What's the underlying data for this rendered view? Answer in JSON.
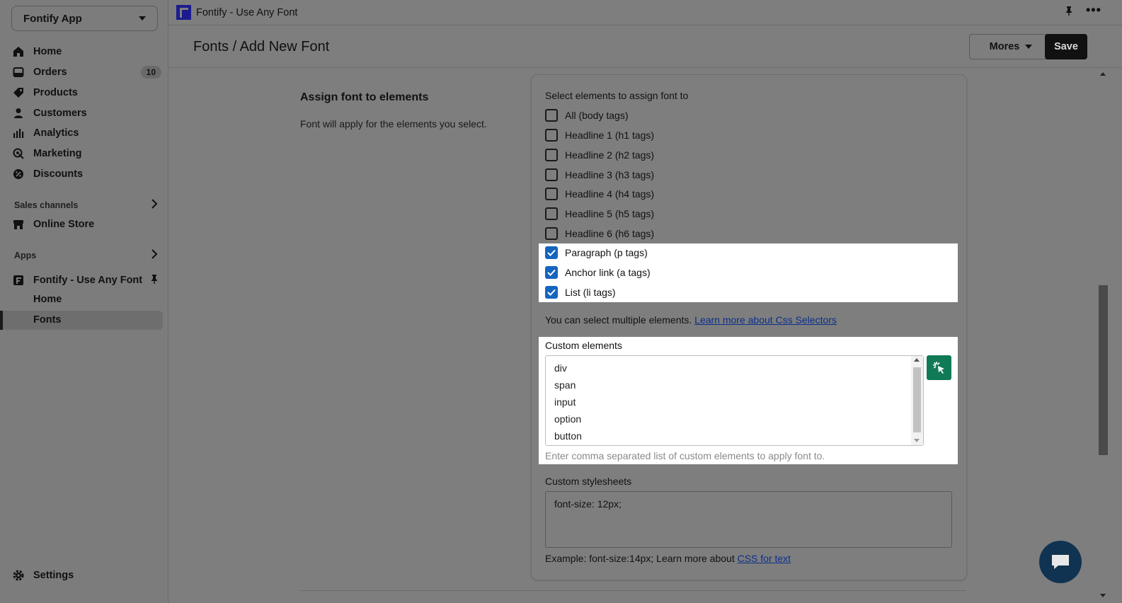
{
  "sidebar": {
    "store_name": "Fontify App",
    "items": [
      {
        "label": "Home",
        "icon": "home-icon"
      },
      {
        "label": "Orders",
        "icon": "orders-icon",
        "badge": "10"
      },
      {
        "label": "Products",
        "icon": "tag-icon"
      },
      {
        "label": "Customers",
        "icon": "person-icon"
      },
      {
        "label": "Analytics",
        "icon": "bar-chart-icon"
      },
      {
        "label": "Marketing",
        "icon": "target-icon"
      },
      {
        "label": "Discounts",
        "icon": "discount-icon"
      }
    ],
    "sales_channels_label": "Sales channels",
    "online_store_label": "Online Store",
    "apps_label": "Apps",
    "app_name": "Fontify - Use Any Font",
    "app_sub_home": "Home",
    "app_sub_fonts": "Fonts",
    "settings_label": "Settings"
  },
  "topbar": {
    "title": "Fontify - Use Any Font"
  },
  "header": {
    "breadcrumb": "Fonts / Add New Font",
    "mores_label": "Mores",
    "save_label": "Save"
  },
  "section": {
    "title": "Assign font to elements",
    "description": "Font will apply for the elements you select."
  },
  "form": {
    "select_label": "Select elements to assign font to",
    "checkboxes": [
      {
        "label": "All (body tags)",
        "checked": false
      },
      {
        "label": "Headline 1 (h1 tags)",
        "checked": false
      },
      {
        "label": "Headline 2 (h2 tags)",
        "checked": false
      },
      {
        "label": "Headline 3 (h3 tags)",
        "checked": false
      },
      {
        "label": "Headline 4 (h4 tags)",
        "checked": false
      },
      {
        "label": "Headline 5 (h5 tags)",
        "checked": false
      },
      {
        "label": "Headline 6 (h6 tags)",
        "checked": false
      },
      {
        "label": "Paragraph (p tags)",
        "checked": true
      },
      {
        "label": "Anchor link (a tags)",
        "checked": true
      },
      {
        "label": "List (li tags)",
        "checked": true
      }
    ],
    "multi_note": "You can select multiple elements.",
    "multi_link": "Learn more about Css Selectors",
    "custom_label": "Custom elements",
    "custom_values": [
      "div",
      "span",
      "input",
      "option",
      "button"
    ],
    "custom_help": "Enter comma separated list of custom elements to apply font to.",
    "stylesheet_label": "Custom stylesheets",
    "stylesheet_value": "font-size: 12px;",
    "example_text": "Example: font-size:14px; Learn more about",
    "example_link": "CSS for text"
  },
  "colors": {
    "accent_blue": "#1565c0",
    "picker_green": "#0f7a55",
    "chat_navy": "#0f3350"
  }
}
